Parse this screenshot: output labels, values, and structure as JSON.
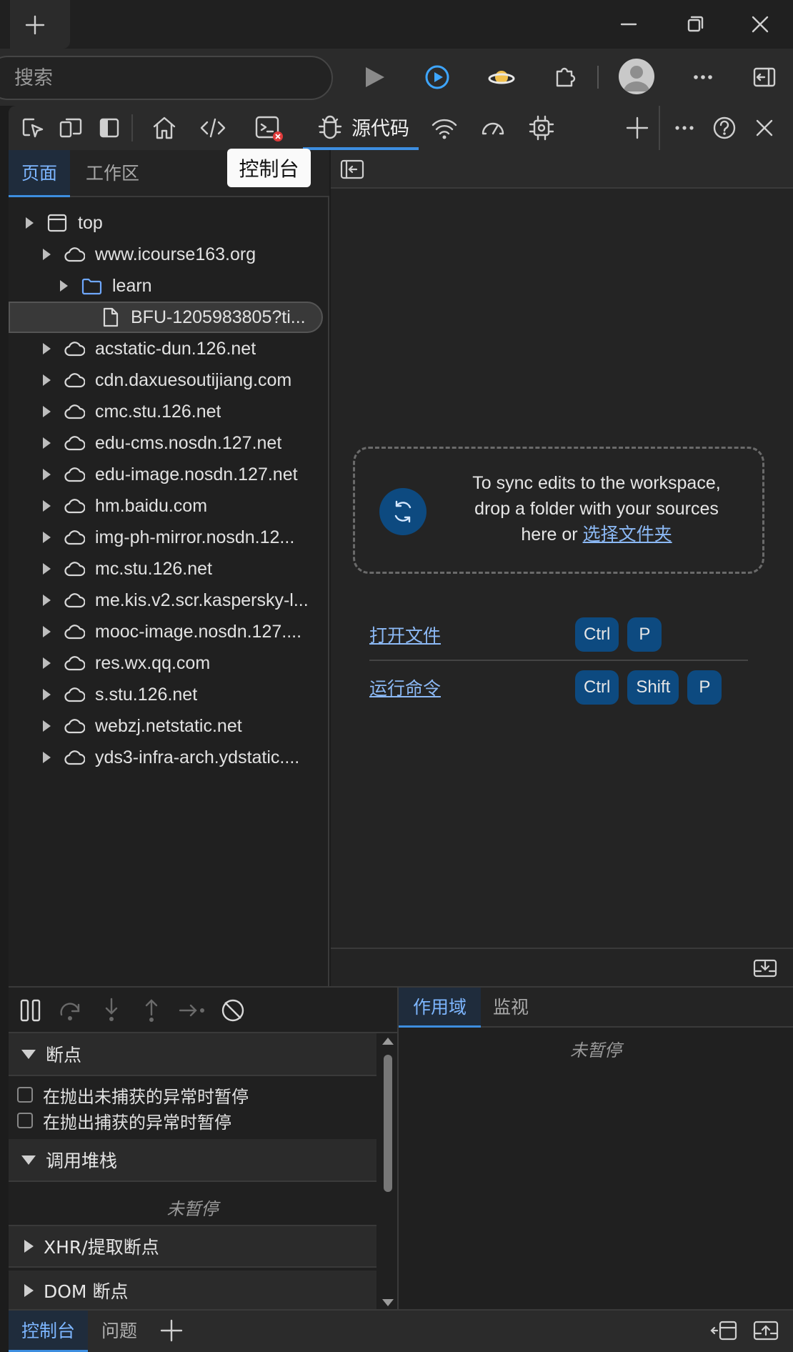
{
  "search": {
    "placeholder": "搜索"
  },
  "devtools": {
    "sources_tab_label": "源代码",
    "tooltip": "控制台"
  },
  "navigator": {
    "tabs": [
      {
        "label": "页面",
        "active": true
      },
      {
        "label": "工作区",
        "active": false
      }
    ],
    "tree": [
      {
        "label": "top",
        "kind": "frame",
        "depth": 0,
        "expandable": true
      },
      {
        "label": "www.icourse163.org",
        "kind": "cloud",
        "depth": 1,
        "expandable": true
      },
      {
        "label": "learn",
        "kind": "folder",
        "depth": 2,
        "expandable": true
      },
      {
        "label": "BFU-1205983805?ti...",
        "kind": "file",
        "depth": 3,
        "expandable": false,
        "selected": true
      },
      {
        "label": "acstatic-dun.126.net",
        "kind": "cloud",
        "depth": 1,
        "expandable": true
      },
      {
        "label": "cdn.daxuesoutijiang.com",
        "kind": "cloud",
        "depth": 1,
        "expandable": true
      },
      {
        "label": "cmc.stu.126.net",
        "kind": "cloud",
        "depth": 1,
        "expandable": true
      },
      {
        "label": "edu-cms.nosdn.127.net",
        "kind": "cloud",
        "depth": 1,
        "expandable": true
      },
      {
        "label": "edu-image.nosdn.127.net",
        "kind": "cloud",
        "depth": 1,
        "expandable": true
      },
      {
        "label": "hm.baidu.com",
        "kind": "cloud",
        "depth": 1,
        "expandable": true
      },
      {
        "label": "img-ph-mirror.nosdn.12...",
        "kind": "cloud",
        "depth": 1,
        "expandable": true
      },
      {
        "label": "mc.stu.126.net",
        "kind": "cloud",
        "depth": 1,
        "expandable": true
      },
      {
        "label": "me.kis.v2.scr.kaspersky-l...",
        "kind": "cloud",
        "depth": 1,
        "expandable": true
      },
      {
        "label": "mooc-image.nosdn.127....",
        "kind": "cloud",
        "depth": 1,
        "expandable": true
      },
      {
        "label": "res.wx.qq.com",
        "kind": "cloud",
        "depth": 1,
        "expandable": true
      },
      {
        "label": "s.stu.126.net",
        "kind": "cloud",
        "depth": 1,
        "expandable": true
      },
      {
        "label": "webzj.netstatic.net",
        "kind": "cloud",
        "depth": 1,
        "expandable": true
      },
      {
        "label": "yds3-infra-arch.ydstatic....",
        "kind": "cloud",
        "depth": 1,
        "expandable": true
      }
    ]
  },
  "editor": {
    "drop_line1": "To sync edits to the workspace,",
    "drop_line2": "drop a folder with your sources",
    "drop_line3_prefix": "here or ",
    "drop_link": "选择文件夹",
    "shortcuts": [
      {
        "label": "打开文件",
        "keys": [
          "Ctrl",
          "P"
        ]
      },
      {
        "label": "运行命令",
        "keys": [
          "Ctrl",
          "Shift",
          "P"
        ]
      }
    ]
  },
  "debugger": {
    "breakpoints_title": "断点",
    "pause_uncaught": "在抛出未捕获的异常时暂停",
    "pause_caught": "在抛出捕获的异常时暂停",
    "callstack_title": "调用堆栈",
    "not_paused": "未暂停",
    "xhr_title": "XHR/提取断点",
    "dom_title": "DOM 断点"
  },
  "scope": {
    "tabs": [
      {
        "label": "作用域",
        "active": true
      },
      {
        "label": "监视",
        "active": false
      }
    ],
    "not_paused": "未暂停"
  },
  "drawer": {
    "tabs": [
      {
        "label": "控制台",
        "active": true
      },
      {
        "label": "问题",
        "active": false
      }
    ]
  },
  "colors": {
    "accent": "#3d8ee0",
    "key_bg": "#0d4a80",
    "link": "#8cb9f5",
    "panel_bg": "#202020"
  }
}
